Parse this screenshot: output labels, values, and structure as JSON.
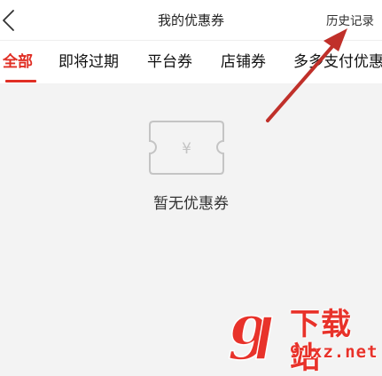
{
  "header": {
    "title": "我的优惠券",
    "history_label": "历史记录",
    "back_icon": "chevron-left-icon"
  },
  "tabs": [
    {
      "label": "全部",
      "active": true
    },
    {
      "label": "即将过期",
      "active": false
    },
    {
      "label": "平台券",
      "active": false
    },
    {
      "label": "店铺券",
      "active": false
    },
    {
      "label": "多多支付优惠",
      "active": false
    }
  ],
  "empty_state": {
    "icon": "coupon-ticket-icon",
    "icon_symbol": "¥",
    "message": "暂无优惠券"
  },
  "watermark": {
    "logo_text": "9",
    "name": "下载站",
    "domain": "91xz.net"
  },
  "colors": {
    "accent": "#e02e24",
    "background": "#f3f3f3",
    "surface": "#ffffff",
    "annotation_arrow": "#c0302a",
    "watermark": "#e8322a"
  }
}
